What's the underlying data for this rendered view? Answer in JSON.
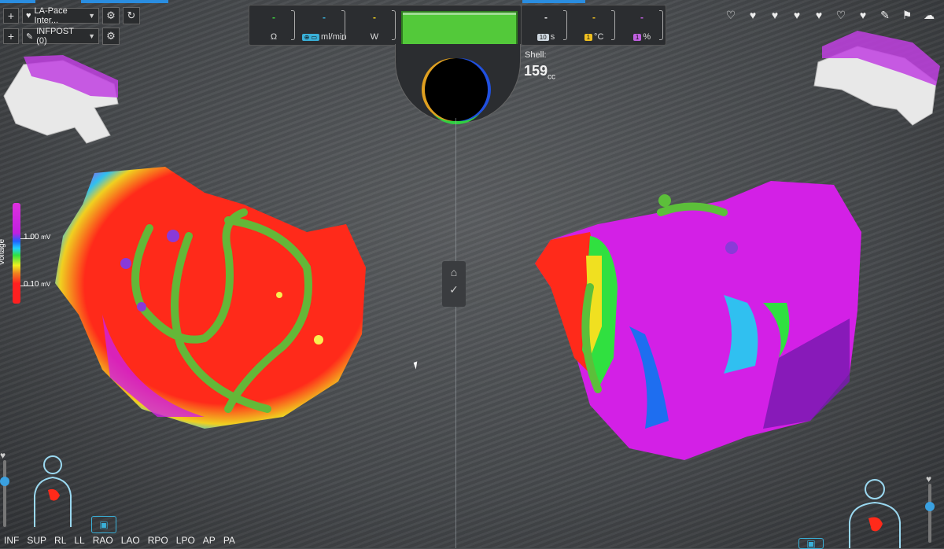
{
  "toolbar": {
    "map1_name": "LA-Pace Inter...",
    "map2_name": "INFPOST (0)"
  },
  "top_readouts": {
    "ohm": {
      "value": "-",
      "unit": "Ω"
    },
    "force": {
      "value": "-",
      "unit": "ml/min"
    },
    "watt": {
      "value": "-",
      "unit": "W"
    },
    "time": {
      "value": "-",
      "chip": "10",
      "unit": "s"
    },
    "temp": {
      "value": "-",
      "chip": "1",
      "unit": "°C"
    },
    "pct": {
      "value": "-",
      "chip": "1",
      "unit": "%"
    }
  },
  "shell": {
    "label": "Shell:",
    "value": "159",
    "unit": "cc"
  },
  "voltage_scale": {
    "label": "Voltage",
    "high": "1.00",
    "low": "0.10",
    "unit": "mV"
  },
  "views": [
    "INF",
    "SUP",
    "RL",
    "LL",
    "RAO",
    "LAO",
    "RPO",
    "LPO",
    "AP",
    "PA"
  ],
  "colors": {
    "accent": "#2a8de0",
    "high": "#e030e0",
    "low": "#ff2020",
    "lesion": "#5cbf3a"
  }
}
